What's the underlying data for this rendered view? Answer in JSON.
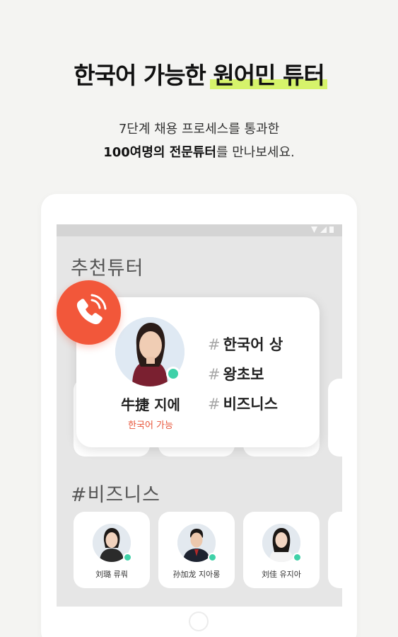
{
  "headline": {
    "part1": "한국어 가능한",
    "highlight": "원어민 튜터"
  },
  "subtitle": {
    "line1": "7단계 채용 프로세스를 통과한",
    "line2_bold": "100여명의 전문튜터",
    "line2_rest": "를 만나보세요."
  },
  "section_recommended": {
    "title": "추천튜터"
  },
  "featured_tutor": {
    "name": "牛捷 지에",
    "language_badge": "한국어 가능",
    "tags": [
      {
        "hash": "#",
        "label": "한국어 상"
      },
      {
        "hash": "#",
        "label": "왕초보"
      },
      {
        "hash": "#",
        "label": "비즈니스"
      }
    ]
  },
  "section_business": {
    "title": "#비즈니스",
    "tutors": [
      {
        "name": "刘璐 류뤄"
      },
      {
        "name": "孙加龙 지아롱"
      },
      {
        "name": "刘佳 유지아"
      }
    ]
  },
  "colors": {
    "accent": "#f2573a",
    "highlight": "#d6f36b",
    "online": "#3fd1a8"
  },
  "icons": {
    "call": "phone-ringing-icon",
    "online": "online-status-dot"
  }
}
